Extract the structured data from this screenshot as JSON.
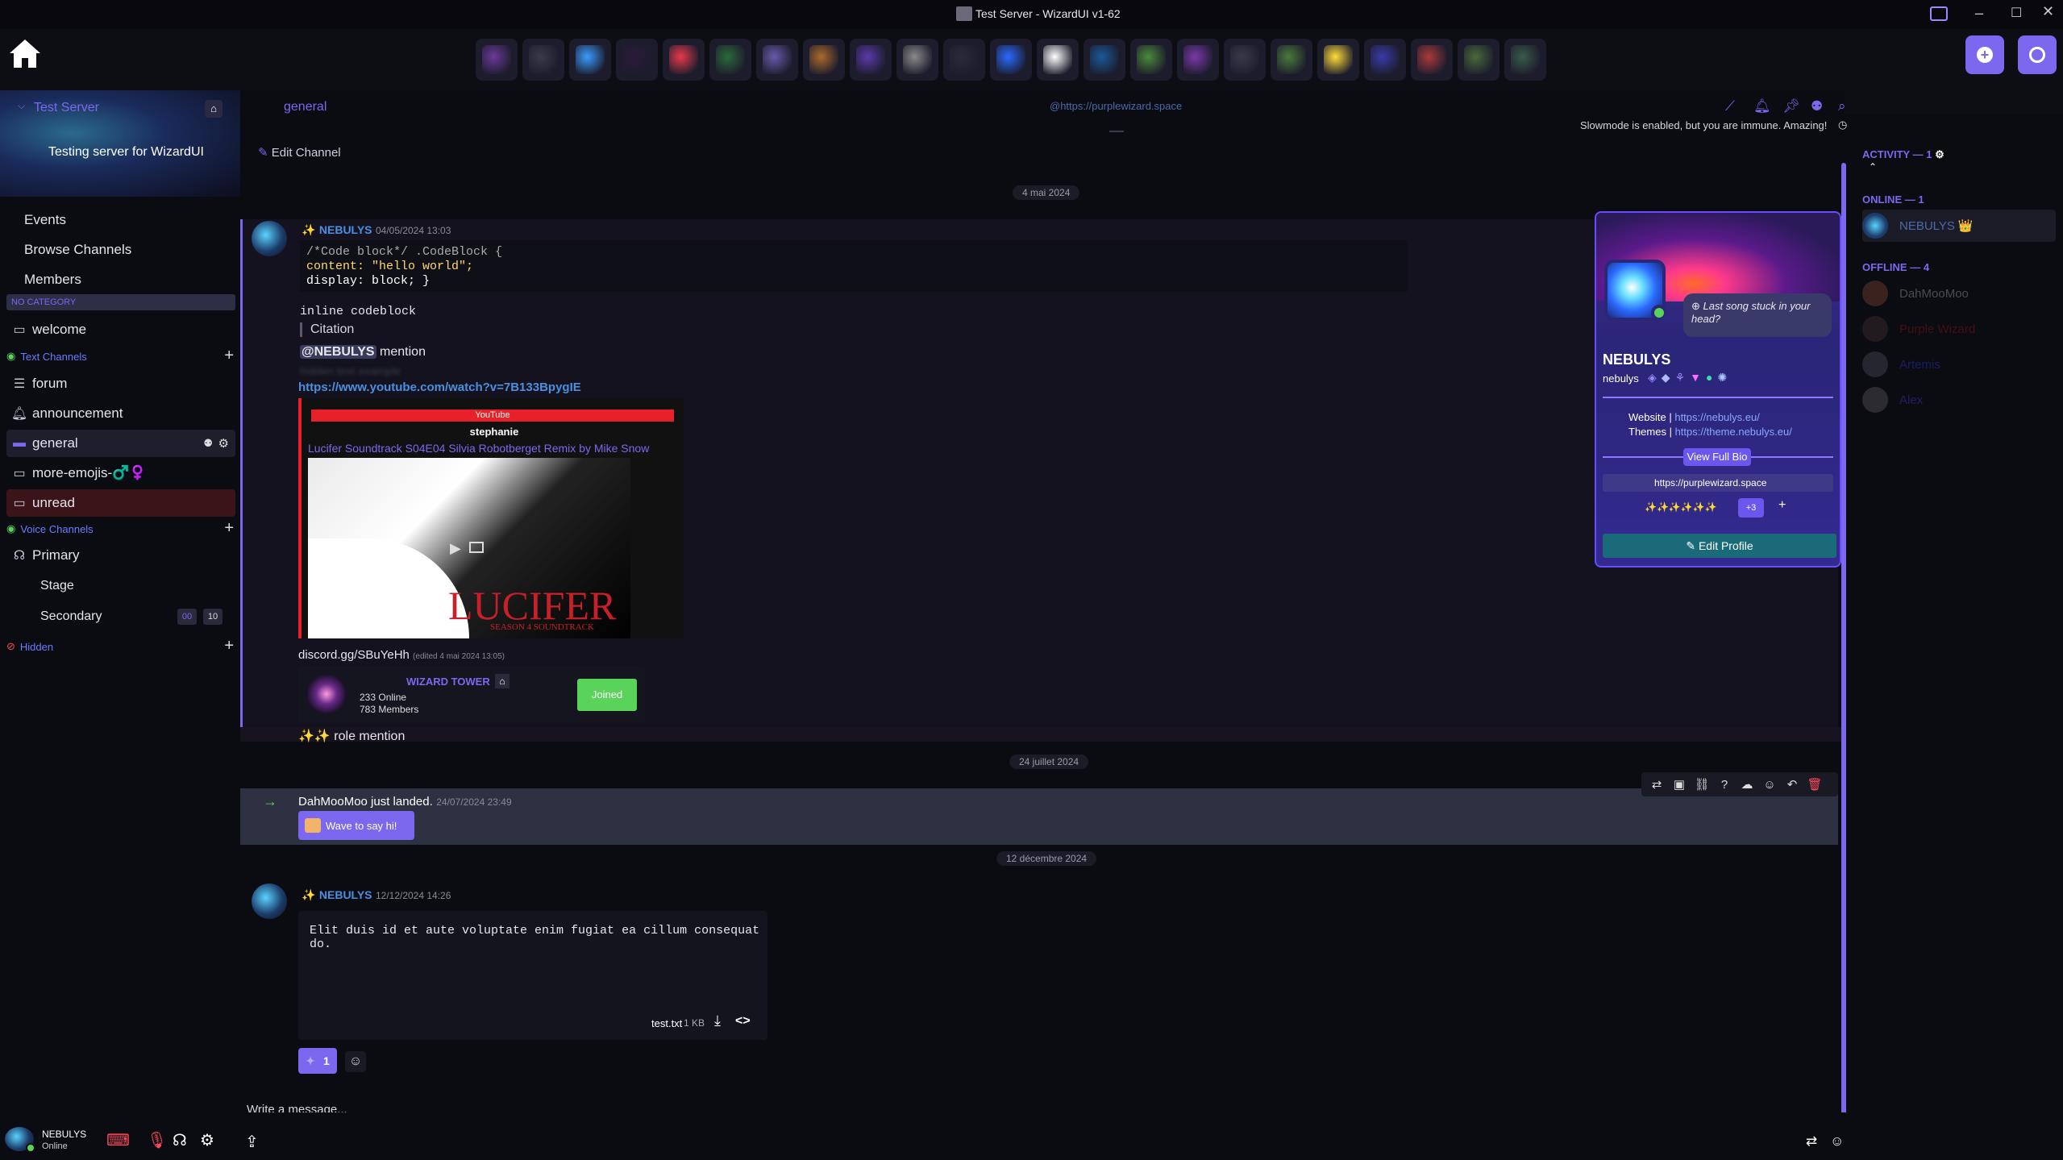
{
  "window": {
    "title": "Test Server - WizardUI v1-62",
    "controls": [
      "minimize-icon",
      "maximize-icon",
      "close-icon"
    ]
  },
  "server_bar": {
    "home_icon": "home-icon",
    "servers": [
      "#6b3a9a",
      "#3a3a4a",
      "#3a9cff",
      "#2a1a3a",
      "#e83a4a",
      "#2a6a3a",
      "#6a5aaa",
      "#aa6a2a",
      "#5a3aaa",
      "#8a8a8a",
      "#2a2a3a",
      "#2a6aff",
      "#ffffff",
      "#1a5a9a",
      "#4a8a3a",
      "#7a3aaa",
      "#3a3a4a",
      "#4a7a3a",
      "#ffdd3a",
      "#3a3aaa",
      "#aa3a3a",
      "#4a6a3a",
      "#3a5a4a"
    ],
    "right_buttons": [
      "add-server-icon",
      "explore-icon"
    ]
  },
  "server": {
    "name": "Test Server",
    "description": "Testing server for WizardUI",
    "nav": [
      "Events",
      "Browse Channels",
      "Members"
    ],
    "no_category_label": "NO CATEGORY",
    "welcome": "welcome",
    "text_channels_label": "Text Channels",
    "text_channels": [
      {
        "name": "forum",
        "icon": "forum-icon"
      },
      {
        "name": "announcement",
        "icon": "announcement-icon"
      },
      {
        "name": "general",
        "icon": "chat-icon"
      },
      {
        "name": "more-emojis-♂️♀️",
        "icon": "chat-icon"
      },
      {
        "name": "unread",
        "icon": "chat-icon"
      }
    ],
    "voice_channels_label": "Voice Channels",
    "voice_channels": [
      {
        "name": "Primary",
        "icon": "voice-icon"
      },
      {
        "name": "Stage",
        "icon": ""
      },
      {
        "name": "Secondary",
        "icon": ""
      }
    ],
    "secondary_badges": [
      "00",
      "10"
    ],
    "hidden_label": "Hidden"
  },
  "channel_header": {
    "name": "general",
    "topic_link": "@https://purplewizard.space",
    "slowmode_text": "Slowmode is enabled, but you are immune. Amazing!",
    "edit_channel": "Edit Channel",
    "icons": [
      "threads-icon",
      "bell-icon",
      "pin-icon",
      "members-icon",
      "search-icon"
    ]
  },
  "messages": {
    "date1": "4 mai 2024",
    "m1": {
      "author": "NEBULYS",
      "prefix": "✨",
      "timestamp": "04/05/2024 13:03",
      "code_lines": [
        "/*Code block*/ .CodeBlock {",
        "content: \"hello world\";",
        "display: block; }"
      ],
      "inline_code": "inline codeblock",
      "citation": "Citation",
      "mention": "@NEBULYS",
      "mention_suffix": " mention",
      "spoiler": "hidden text example",
      "link": "https://www.youtube.com/watch?v=7B133BpygIE",
      "embed": {
        "provider": "YouTube",
        "author": "stephanie",
        "title": "Lucifer Soundtrack S04E04 Silvia Robotberget Remix by Mike Snow",
        "image_title": "LUCIFER",
        "image_sub": "SEASON 4 SOUNDTRACK"
      },
      "invite_link": "discord.gg/SBuYeHh",
      "edited": "(edited 4 mai 2024 13:05)",
      "invite": {
        "name": "WIZARD TOWER",
        "online": "233 Online",
        "members": "783 Members",
        "button": "Joined"
      },
      "role_mention": "✨✨ role mention"
    },
    "date2": "24 juillet 2024",
    "system": {
      "text": "DahMooMoo just landed.",
      "timestamp": "24/07/2024 23:49",
      "wave_button": "Wave to say hi!",
      "actions": [
        "translate-icon",
        "id-icon",
        "link-icon",
        "help-icon",
        "reply-thread-icon",
        "reaction-icon",
        "reply-icon",
        "delete-icon"
      ]
    },
    "date3": "12 décembre 2024",
    "m2": {
      "author": "NEBULYS",
      "prefix": "✨",
      "timestamp": "12/12/2024 14:26",
      "file_content": "Elit duis id et aute voluptate enim fugiat ea cillum consequat do.",
      "file_name": "test.txt",
      "file_size": "1 KB",
      "reaction_count": "1"
    }
  },
  "composer": {
    "placeholder": "Write a message..."
  },
  "profile_popup": {
    "status": "Last song stuck in your head?",
    "display_name": "NEBULYS",
    "username": "nebulys",
    "website_label": "Website",
    "website": "https://nebulys.eu/",
    "themes_label": "Themes",
    "themes": "https://theme.nebulys.eu/",
    "view_bio": "View Full Bio",
    "connection": "https://purplewizard.space",
    "roles_text": "✨✨✨✨✨✨",
    "roles_more": "+3",
    "edit_button": "Edit Profile"
  },
  "members_panel": {
    "activity_label": "ACTIVITY — 1",
    "online_label": "ONLINE — 1",
    "online": [
      {
        "name": "NEBULYS",
        "suffix": "👑"
      }
    ],
    "offline_label": "OFFLINE — 4",
    "offline": [
      {
        "name": "DahMooMoo",
        "color": "#8a8a99"
      },
      {
        "name": "Purple Wizard",
        "color": "#7a1a1a"
      },
      {
        "name": "Artemis",
        "color": "#2a2aaa"
      },
      {
        "name": "Alex",
        "color": "#3a2aaa"
      }
    ]
  },
  "user_panel": {
    "name": "NEBULYS",
    "status": "Online"
  },
  "colors": {
    "accent": "#7b68ee",
    "link": "#4a90e2",
    "green": "#5ad35a",
    "danger": "#ff4a5a"
  }
}
